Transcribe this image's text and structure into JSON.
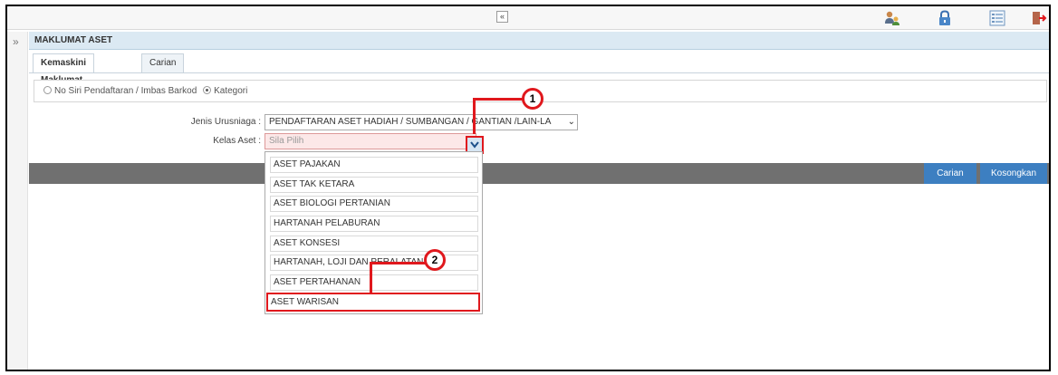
{
  "topbar": {
    "collapse_glyph": "«",
    "icons": [
      "user-switch-icon",
      "lock-icon",
      "list-icon",
      "logout-icon"
    ]
  },
  "sidebar": {
    "expand_glyph": "»"
  },
  "panel": {
    "title": "MAKLUMAT ASET"
  },
  "tabs": [
    {
      "label": "Kemaskini Maklumat",
      "active": true
    },
    {
      "label": "Carian",
      "active": false
    }
  ],
  "search_mode": {
    "options": [
      {
        "label": "No Siri Pendaftaran / Imbas Barkod",
        "selected": false
      },
      {
        "label": "Kategori",
        "selected": true
      }
    ]
  },
  "form": {
    "jenis_label": "Jenis Urusniaga :",
    "jenis_value": "PENDAFTARAN ASET HADIAH / SUMBANGAN / GANTIAN /LAIN-LA",
    "kelas_label": "Kelas Aset :",
    "kelas_placeholder": "Sila Pilih"
  },
  "actions": {
    "search_label": "Carian",
    "clear_label": "Kosongkan"
  },
  "dropdown_options": [
    "ASET PAJAKAN",
    "ASET TAK KETARA",
    "ASET BIOLOGI PERTANIAN",
    "HARTANAH PELABURAN",
    "ASET KONSESI",
    "HARTANAH, LOJI DAN PERALATAN",
    "ASET PERTAHANAN",
    "ASET WARISAN"
  ],
  "callouts": [
    "1",
    "2"
  ],
  "colors": {
    "accent_red": "#e0181d",
    "header_blue": "#dbe9f3",
    "button_blue": "#3d7fc1",
    "bar_grey": "#707070"
  }
}
